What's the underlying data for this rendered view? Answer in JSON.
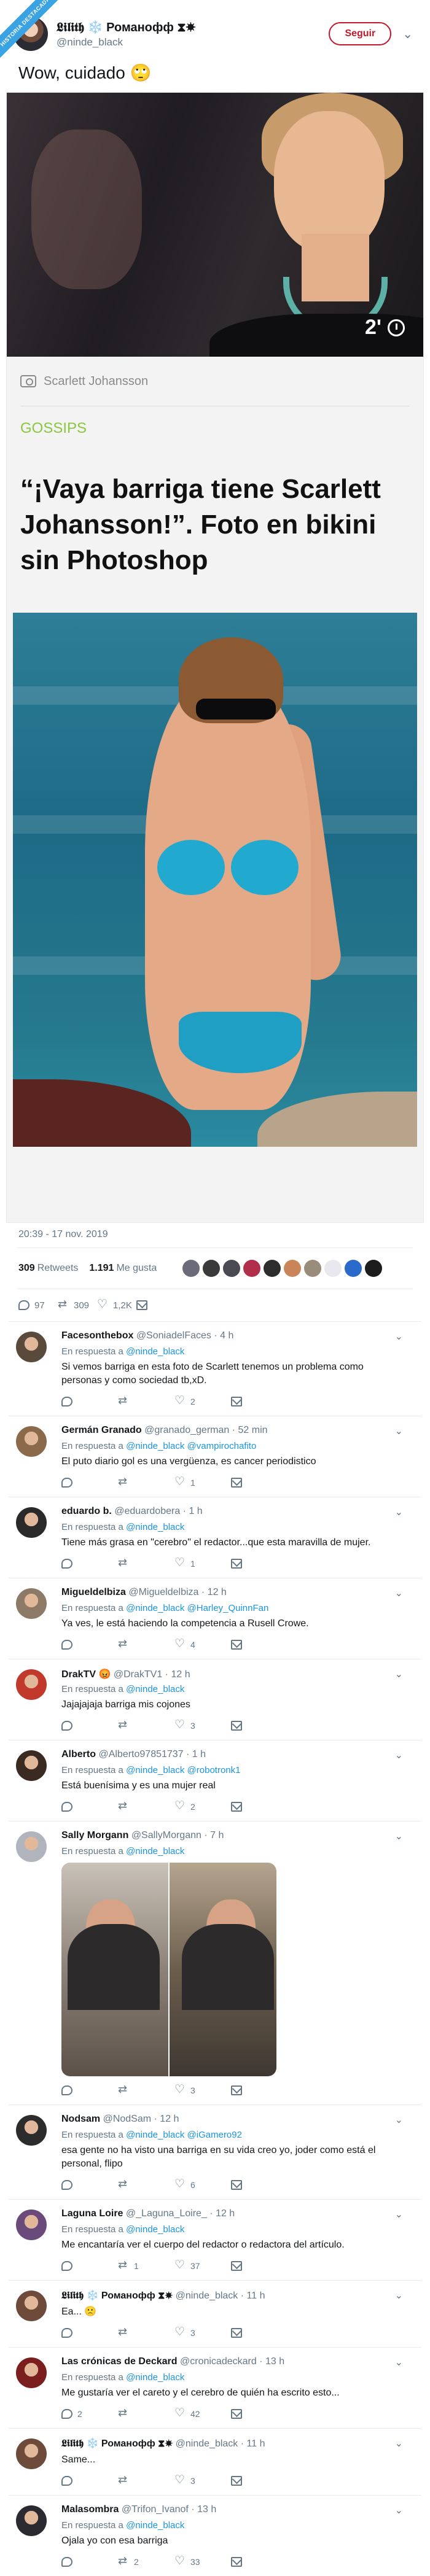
{
  "corner_badge": "HISTORIA DESTACADA",
  "tweet": {
    "display_name": "𝕷𝖎𝖑𝖎𝖙𝖍 ❄️ Романoфф ⧗☀",
    "handle": "@ninde_black",
    "follow_label": "Seguir",
    "text": "Wow, cuidado 🙄",
    "video_duration": "2'",
    "card": {
      "photo_credit": "Scarlett Johansson",
      "category": "GOSSIPS",
      "headline": "“¡Vaya barriga tiene Scarlett Johansson!”. Foto en bikini sin Photoshop"
    },
    "timestamp": "20:39 - 17 nov. 2019",
    "retweets_count": "309",
    "retweets_label": "Retweets",
    "likes_count": "1.191",
    "likes_label": "Me gusta",
    "action_counts": {
      "reply": "97",
      "retweet": "309",
      "like": "1,2K"
    },
    "liker_colors": [
      "#6b6b7a",
      "#3a3a3a",
      "#4a4a55",
      "#b22f4b",
      "#2d2d2d",
      "#c9855a",
      "#9a8c7a",
      "#e8e8ee",
      "#2a6acb",
      "#1c1c1c"
    ]
  },
  "replies": [
    {
      "name": "Facesonthebox",
      "handle": "@SoniadelFaces",
      "time": "· 4 h",
      "reply_prefix": "En respuesta a",
      "reply_to": "@ninde_black",
      "text": "Si vemos barriga en esta foto de Scarlett tenemos un problema como personas y como sociedad tb,xD.",
      "counts": {
        "reply": "",
        "retweet": "",
        "like": "2"
      },
      "avatar_color": "#5a4a3c"
    },
    {
      "name": "Germán Granado",
      "handle": "@granado_german",
      "time": "· 52 min",
      "reply_prefix": "En respuesta a",
      "reply_to": "@ninde_black @vampirochafito",
      "text": "El puto diario gol es una vergüenza, es cancer periodistico",
      "counts": {
        "reply": "",
        "retweet": "",
        "like": "1"
      },
      "avatar_color": "#8a6a4a"
    },
    {
      "name": "eduardo b.",
      "handle": "@eduardobera",
      "time": "· 1 h",
      "reply_prefix": "En respuesta a",
      "reply_to": "@ninde_black",
      "text": "Tiene más grasa en \"cerebro\" el redactor...que esta maravilla de mujer.",
      "counts": {
        "reply": "",
        "retweet": "",
        "like": "1"
      },
      "avatar_color": "#2a2a2a"
    },
    {
      "name": "Migueldelbiza",
      "handle": "@Migueldelbiza",
      "time": "· 12 h",
      "reply_prefix": "En respuesta a",
      "reply_to": "@ninde_black @Harley_QuinnFan",
      "text": "Ya ves, le está haciendo la competencia a Rusell Crowe.",
      "counts": {
        "reply": "",
        "retweet": "",
        "like": "4"
      },
      "avatar_color": "#8c7a66"
    },
    {
      "name": "DrakTV 😡",
      "handle": "@DrakTV1",
      "time": "· 12 h",
      "reply_prefix": "En respuesta a",
      "reply_to": "@ninde_black",
      "text": "Jajajajaja barriga mis cojones",
      "counts": {
        "reply": "",
        "retweet": "",
        "like": "3"
      },
      "avatar_color": "#c0392b"
    },
    {
      "name": "Alberto",
      "handle": "@Alberto97851737",
      "time": "· 1 h",
      "reply_prefix": "En respuesta a",
      "reply_to": "@ninde_black @robotronk1",
      "text": "Está buenísima y es una mujer real",
      "counts": {
        "reply": "",
        "retweet": "",
        "like": "2"
      },
      "avatar_color": "#3b2a22"
    },
    {
      "name": "Sally Morgann",
      "handle": "@SallyMorgann",
      "time": "· 7 h",
      "reply_prefix": "En respuesta a",
      "reply_to": "@ninde_black",
      "text": "",
      "counts": {
        "reply": "",
        "retweet": "",
        "like": "3"
      },
      "avatar_color": "#b0b4bc"
    },
    {
      "name": "Nodsam",
      "handle": "@NodSam",
      "time": "· 12 h",
      "reply_prefix": "En respuesta a",
      "reply_to": "@ninde_black @iGamero92",
      "text": "esa gente no ha visto una barriga en su vida creo yo, joder como está el personal, flipo",
      "counts": {
        "reply": "",
        "retweet": "",
        "like": "6"
      },
      "avatar_color": "#2c2c2c"
    },
    {
      "name": "Laguna Loire",
      "handle": "@_Laguna_Loire_",
      "time": "· 12 h",
      "reply_prefix": "En respuesta a",
      "reply_to": "@ninde_black",
      "text": "Me encantaría ver el cuerpo del redactor o redactora del artículo.",
      "counts": {
        "reply": "",
        "retweet": "1",
        "like": "37"
      },
      "avatar_color": "#6a4a7a"
    },
    {
      "name": "𝕷𝖎𝖑𝖎𝖙𝖍 ❄️ Романoфф ⧗☀",
      "handle": "@ninde_black",
      "time": "· 11 h",
      "reply_prefix": "",
      "reply_to": "",
      "text": "Ea... 🙁",
      "counts": {
        "reply": "",
        "retweet": "",
        "like": "3"
      },
      "avatar_color": "#6e4a3a"
    },
    {
      "name": "Las crónicas de Deckard",
      "handle": "@cronicadeckard",
      "time": "· 13 h",
      "reply_prefix": "En respuesta a",
      "reply_to": "@ninde_black",
      "text": "Me gustaría ver el careto y el cerebro de quién ha escrito esto...",
      "counts": {
        "reply": "2",
        "retweet": "",
        "like": "42"
      },
      "avatar_color": "#7a1e1e"
    },
    {
      "name": "𝕷𝖎𝖑𝖎𝖙𝖍 ❄️ Романoфф ⧗☀",
      "handle": "@ninde_black",
      "time": "· 11 h",
      "reply_prefix": "",
      "reply_to": "",
      "text": "Same...",
      "counts": {
        "reply": "",
        "retweet": "",
        "like": "3"
      },
      "avatar_color": "#6e4a3a"
    },
    {
      "name": "Malasombra",
      "handle": "@Trifon_Ivanof",
      "time": "· 13 h",
      "reply_prefix": "En respuesta a",
      "reply_to": "@ninde_black",
      "text": "Ojala yo con esa barriga",
      "counts": {
        "reply": "",
        "retweet": "2",
        "like": "33"
      },
      "avatar_color": "#2a2a30"
    }
  ]
}
